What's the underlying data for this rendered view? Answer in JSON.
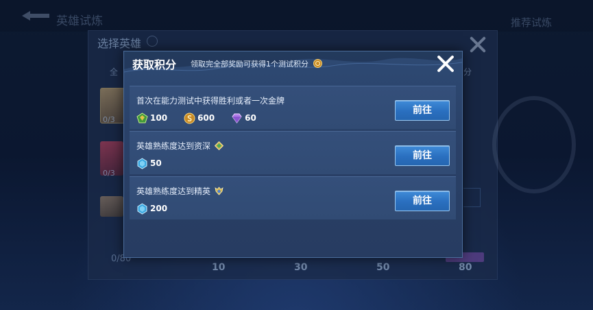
{
  "background": {
    "top_title": "英雄试炼",
    "top_right": "推荐试炼",
    "panel_title": "选择英雄",
    "hero_counts": [
      "0/3",
      "0/3"
    ],
    "tab_partial": "全",
    "right_tab_partial": "分",
    "progress_current": "0/80",
    "milestones": [
      "10",
      "30",
      "50",
      "80"
    ]
  },
  "modal": {
    "title": "获取积分",
    "subtitle": "领取完全部奖励可获得1个测试积分",
    "tasks": [
      {
        "title": "首次在能力测试中获得胜利或者一次金牌",
        "rewards": [
          {
            "icon": "green-gem-icon",
            "value": "100"
          },
          {
            "icon": "gold-coin-icon",
            "value": "600"
          },
          {
            "icon": "purple-diamond-icon",
            "value": "60"
          }
        ],
        "button": "前往"
      },
      {
        "title": "英雄熟练度达到资深",
        "title_icon": "veteran-badge-icon",
        "rewards": [
          {
            "icon": "blue-crystal-icon",
            "value": "50"
          }
        ],
        "button": "前往"
      },
      {
        "title": "英雄熟练度达到精英",
        "title_icon": "elite-badge-icon",
        "rewards": [
          {
            "icon": "blue-crystal-icon",
            "value": "200"
          }
        ],
        "button": "前往"
      }
    ]
  },
  "colors": {
    "modal_bg": "#2a4168",
    "button": "#2a6fbf",
    "button_border": "#9ac9f2"
  }
}
